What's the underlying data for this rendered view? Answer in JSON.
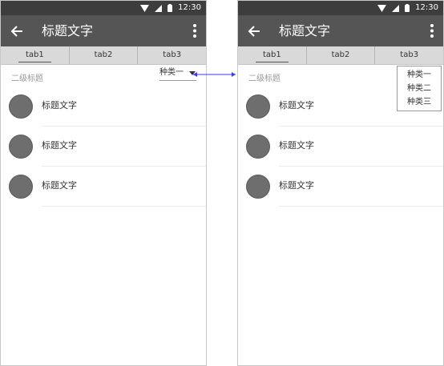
{
  "status": {
    "time": "12:30"
  },
  "appbar": {
    "title": "标题文字"
  },
  "tabs": [
    {
      "label": "tab1"
    },
    {
      "label": "tab2"
    },
    {
      "label": "tab3"
    }
  ],
  "subheader": "二级标题",
  "dropdown": {
    "selected": "种类一",
    "options": [
      "种类一",
      "种类二",
      "种类三"
    ]
  },
  "list": [
    {
      "title": "标题文字"
    },
    {
      "title": "标题文字"
    },
    {
      "title": "标题文字"
    }
  ],
  "colors": {
    "connector": "#3a3aff",
    "appbar": "#555555",
    "statusbar": "#3d3d3d"
  }
}
